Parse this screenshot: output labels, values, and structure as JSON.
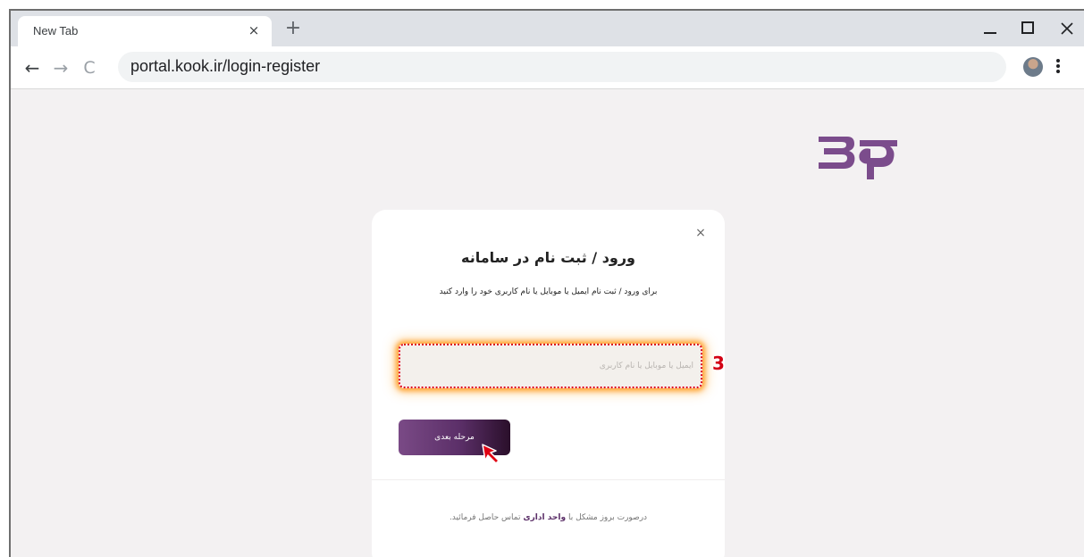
{
  "browser": {
    "tab_title": "New Tab",
    "tab_close": "×",
    "new_tab": "+",
    "url": "portal.kook.ir/login-register",
    "back": "←",
    "forward": "→",
    "reload": "C"
  },
  "logo": {
    "brand_color": "#7b4c8c"
  },
  "dialog": {
    "close": "×",
    "title": "ورود / ثبت نام در سامانه",
    "subtitle": "برای ورود / ثبت نام ایمیل یا موبایل یا نام کاربری خود را وارد کنید",
    "input_placeholder": "ایمیل یا موبایل یا نام کاربری",
    "input_value": "",
    "next_button": "مرحله بعدی",
    "footer_prefix": "درصورت بروز مشکل با",
    "footer_link": "واحد اداری",
    "footer_suffix": "تماس حاصل فرمائید."
  },
  "annotation": {
    "step": "3",
    "highlight_color": "#d9001b"
  },
  "colors": {
    "accent": "#5b2f68",
    "page_bg": "#f3f1f2"
  }
}
